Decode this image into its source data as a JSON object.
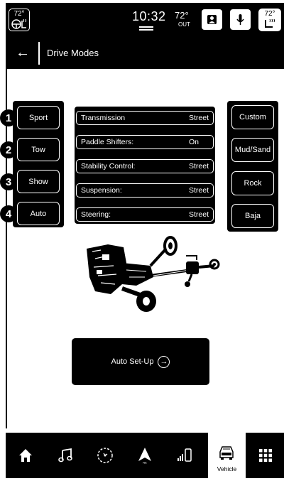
{
  "status_bar": {
    "left_temp": "72°",
    "time": "10:32",
    "outside_temp": "72°",
    "outside_label": "OUT",
    "right_temp": "72°"
  },
  "title_bar": {
    "title": "Drive Modes",
    "back_icon": "back-arrow-icon"
  },
  "left_modes": [
    {
      "number": "1",
      "label": "Sport"
    },
    {
      "number": "2",
      "label": "Tow"
    },
    {
      "number": "3",
      "label": "Show"
    },
    {
      "number": "4",
      "label": "Auto"
    }
  ],
  "settings": [
    {
      "label": "Transmission",
      "value": "Street"
    },
    {
      "label": "Paddle Shifters:",
      "value": "On"
    },
    {
      "label": "Stability Control:",
      "value": "Street"
    },
    {
      "label": "Suspension:",
      "value": "Street"
    },
    {
      "label": "Steering:",
      "value": "Street"
    }
  ],
  "right_modes": [
    {
      "label": "Custom"
    },
    {
      "label": "Mud/Sand"
    },
    {
      "label": "Rock"
    },
    {
      "label": "Baja"
    }
  ],
  "setup_button": {
    "label": "Auto Set-Up"
  },
  "bottom_nav": {
    "items": [
      "home-icon",
      "music-icon",
      "compass-icon",
      "navigation-icon",
      "phone-icon",
      "vehicle-icon",
      "apps-grid-icon"
    ],
    "active_label": "Vehicle"
  }
}
